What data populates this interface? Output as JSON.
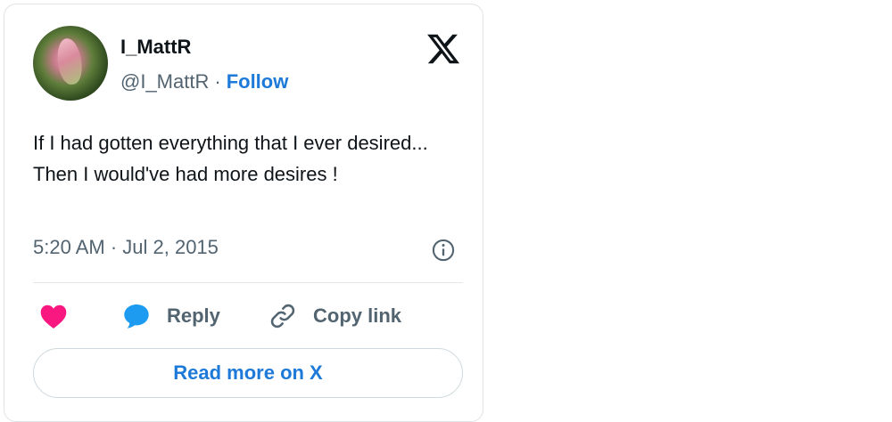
{
  "author": {
    "display_name": "I_MattR",
    "handle": "@I_MattR",
    "separator": "·",
    "follow_label": "Follow",
    "avatar_icon": "flower-bud-avatar"
  },
  "brand": {
    "logo_icon": "x-logo-icon"
  },
  "tweet": {
    "text": "If I had gotten everything that I ever desired... Then I would've had more desires !",
    "timestamp": "5:20 AM · Jul 2, 2015"
  },
  "actions": {
    "like_icon": "heart-icon",
    "reply_label": "Reply",
    "reply_icon": "speech-bubble-icon",
    "copy_label": "Copy link",
    "copy_icon": "link-icon",
    "info_icon": "info-icon"
  },
  "cta": {
    "read_more_label": "Read more on X"
  },
  "colors": {
    "link_blue": "#1d7ad9",
    "like_pink": "#f91880",
    "reply_blue": "#1d9bf0",
    "muted_text": "#536471",
    "primary_text": "#0f1419"
  }
}
